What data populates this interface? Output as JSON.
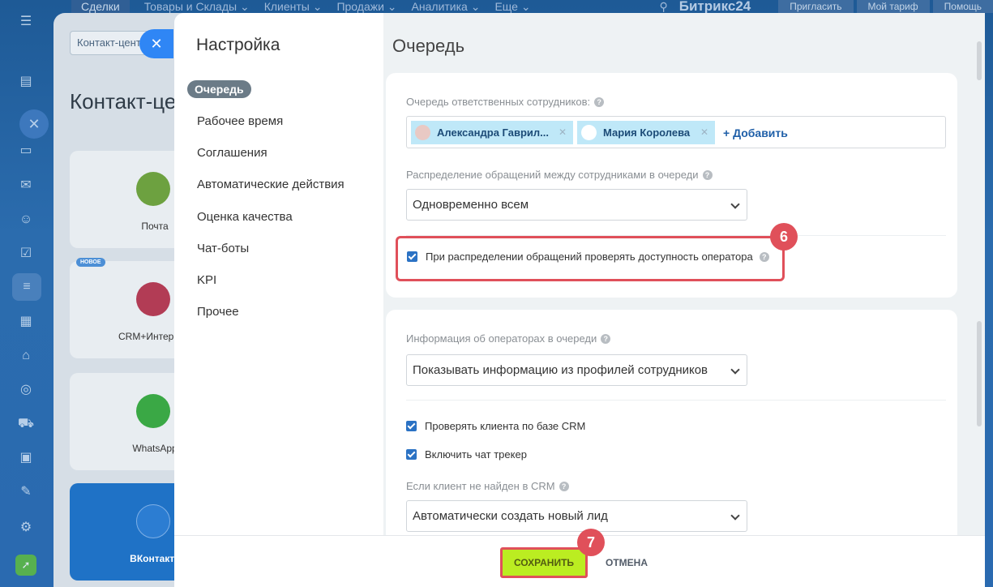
{
  "topnav": {
    "items": [
      "Сделки",
      "Товары и Склады ⌄",
      "Клиенты ⌄",
      "Продажи ⌄",
      "Аналитика ⌄",
      "Еще ⌄"
    ],
    "brand": "Битрикс24",
    "invite": "Пригласить",
    "tariff": "Мой тариф",
    "help": "Помощь"
  },
  "background": {
    "breadcrumb": "Контакт-центр",
    "title": "Контакт-центр",
    "badge_new": "НОВОЕ",
    "cards": [
      "Почта",
      "CRM+Интернет-магазин",
      "WhatsApp",
      "ВКонтакте"
    ]
  },
  "sidebar": {
    "title": "Настройка",
    "items": [
      "Очередь",
      "Рабочее время",
      "Соглашения",
      "Автоматические действия",
      "Оценка качества",
      "Чат-боты",
      "KPI",
      "Прочее"
    ]
  },
  "main": {
    "title": "Очередь",
    "queue_label": "Очередь ответственных сотрудников:",
    "users": [
      "Александра Гаврил...",
      "Мария Королева"
    ],
    "add_label": "+ Добавить",
    "distribution_label": "Распределение обращений между сотрудниками в очереди",
    "distribution_value": "Одновременно всем",
    "check_availability": "При распределении обращений проверять доступность оператора",
    "operator_info_label": "Информация об операторах в очереди",
    "operator_info_value": "Показывать информацию из профилей сотрудников",
    "check_crm": "Проверять клиента по базе CRM",
    "chat_tracker": "Включить чат трекер",
    "not_found_label": "Если клиент не найден в CRM",
    "not_found_value": "Автоматически создать новый лид"
  },
  "footer": {
    "save": "СОХРАНИТЬ",
    "cancel": "ОТМЕНА"
  },
  "steps": [
    "6",
    "7"
  ],
  "colors": {
    "accent": "#2b72c4",
    "save": "#bbed21",
    "highlight": "#e0505a"
  }
}
